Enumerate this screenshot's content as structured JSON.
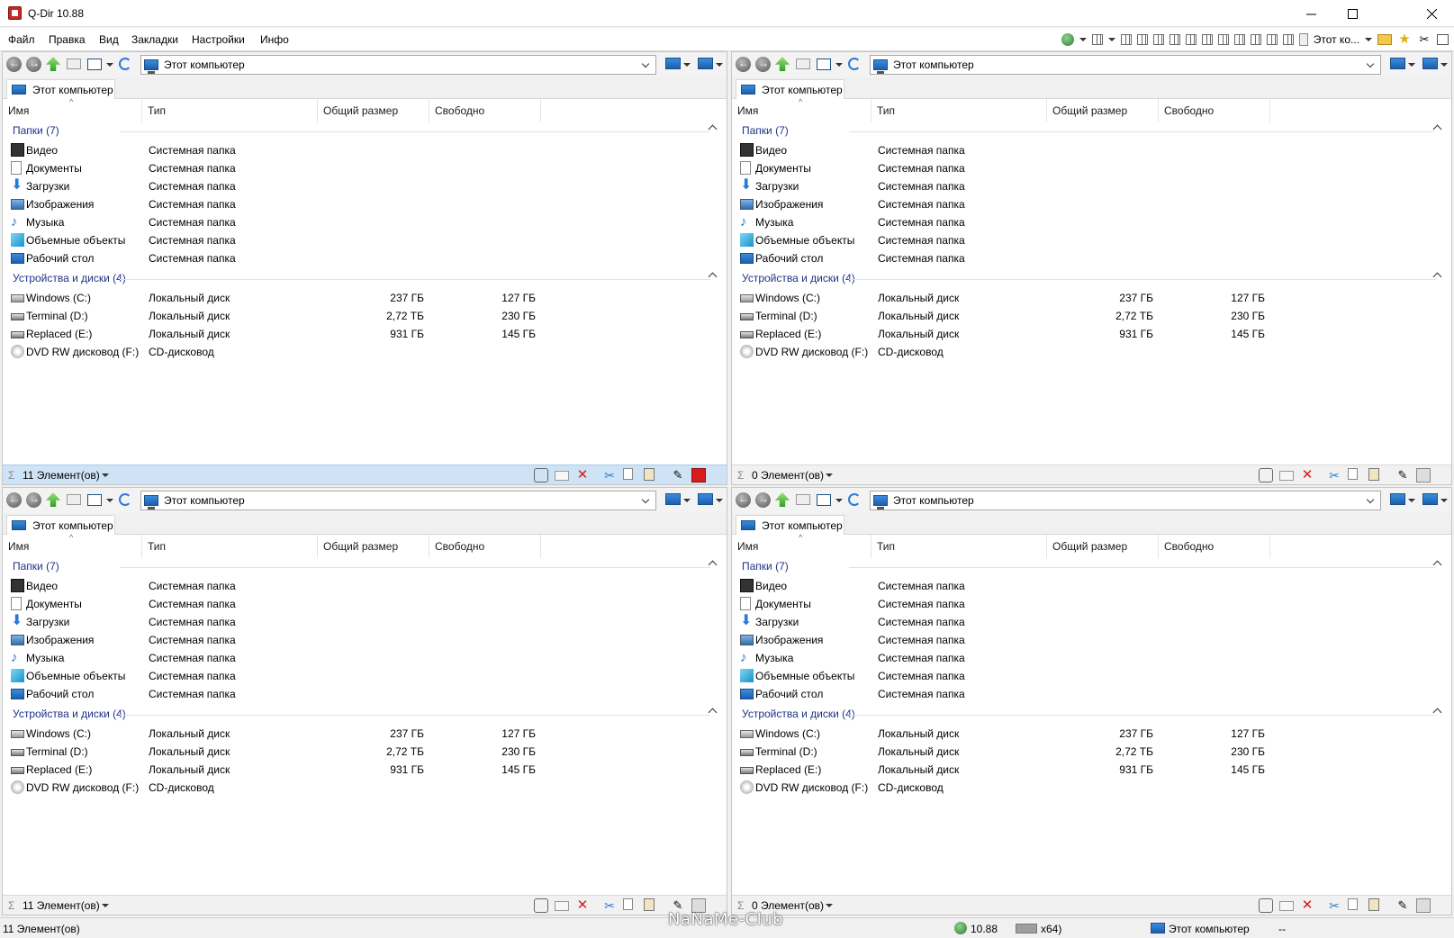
{
  "window": {
    "title": "Q-Dir 10.88"
  },
  "menu": [
    "Файл",
    "Правка",
    "Вид",
    "Закладки",
    "Настройки",
    "Инфо"
  ],
  "toolbar_right": {
    "label": "Этот ко..."
  },
  "panes": [
    {
      "address": "Этот компьютер",
      "tab": "Этот компьютер",
      "status": "11 Элемент(ов)",
      "active": true
    },
    {
      "address": "Этот компьютер",
      "tab": "Этот компьютер",
      "status": "0 Элемент(ов)",
      "active": false
    },
    {
      "address": "Этот компьютер",
      "tab": "Этот компьютер",
      "status": "11 Элемент(ов)",
      "active": false
    },
    {
      "address": "Этот компьютер",
      "tab": "Этот компьютер",
      "status": "0 Элемент(ов)",
      "active": false
    }
  ],
  "columns": [
    "Имя",
    "Тип",
    "Общий размер",
    "Свободно"
  ],
  "groups": {
    "folders": "Папки (7)",
    "drives": "Устройства и диски (4)"
  },
  "folders": [
    {
      "name": "Видео",
      "type": "Системная папка",
      "icon": "video-icon"
    },
    {
      "name": "Документы",
      "type": "Системная папка",
      "icon": "documents-icon"
    },
    {
      "name": "Загрузки",
      "type": "Системная папка",
      "icon": "downloads-icon"
    },
    {
      "name": "Изображения",
      "type": "Системная папка",
      "icon": "pictures-icon"
    },
    {
      "name": "Музыка",
      "type": "Системная папка",
      "icon": "music-icon"
    },
    {
      "name": "Объемные объекты",
      "type": "Системная папка",
      "icon": "3d-objects-icon"
    },
    {
      "name": "Рабочий стол",
      "type": "Системная папка",
      "icon": "desktop-icon"
    }
  ],
  "drives": [
    {
      "name": "Windows (C:)",
      "type": "Локальный диск",
      "total": "237 ГБ",
      "free": "127 ГБ",
      "icon": "windows-drive-icon"
    },
    {
      "name": "Terminal (D:)",
      "type": "Локальный диск",
      "total": "2,72 ТБ",
      "free": "230 ГБ",
      "icon": "drive-icon"
    },
    {
      "name": "Replaced (E:)",
      "type": "Локальный диск",
      "total": "931 ГБ",
      "free": "145 ГБ",
      "icon": "drive-icon"
    },
    {
      "name": "DVD RW дисковод (F:)",
      "type": "CD-дисковод",
      "total": "",
      "free": "",
      "icon": "dvd-drive-icon"
    }
  ],
  "statusbar": {
    "items": "11 Элемент(ов)",
    "version": "10.88",
    "arch": "x64)",
    "location": "Этот компьютер",
    "extra": "--"
  },
  "watermark": "NaNaMe-Club",
  "colors": {
    "group_header": "#1e3287",
    "active_status": "#cfe3f7",
    "accent_blue": "#1c5fae",
    "delete_red": "#d81b1b"
  }
}
